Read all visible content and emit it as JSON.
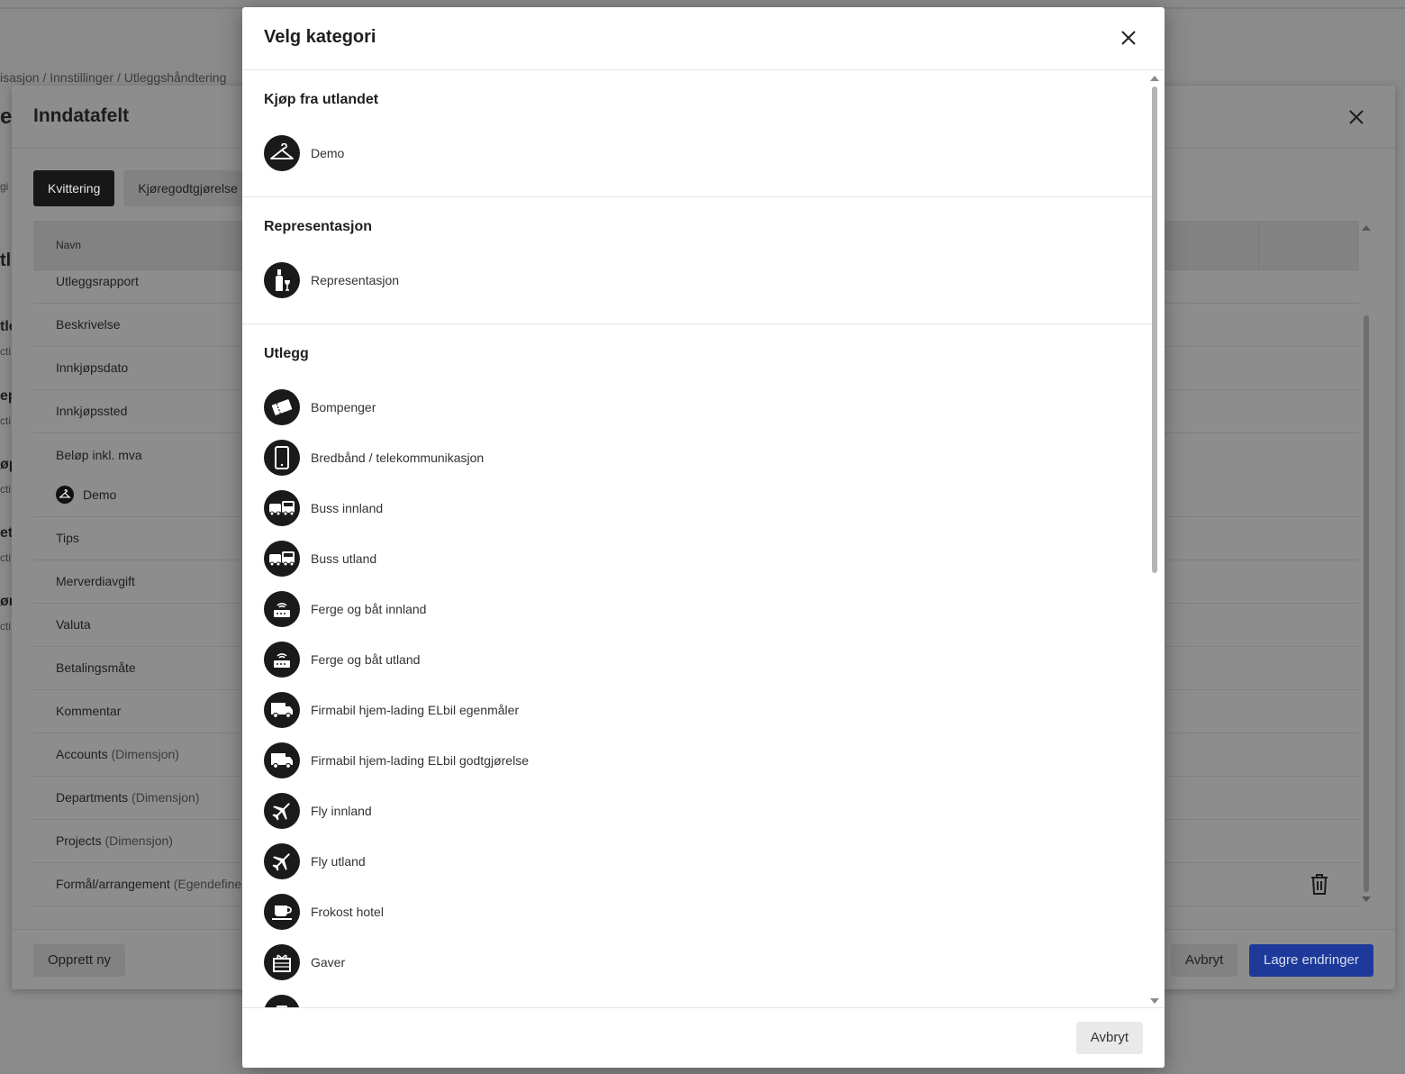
{
  "background": {
    "breadcrumb": "isasjon / Innstillinger / Utleggshåndtering",
    "left_fragments": [
      "e",
      "gi",
      "tl",
      "tle",
      "cti",
      "ep",
      "cti",
      "øp",
      "cti",
      "et",
      "cti",
      "ør",
      "cti"
    ]
  },
  "inndatafelt_modal": {
    "title": "Inndatafelt",
    "tabs": [
      "Kvittering",
      "Kjøregodtgjørelse"
    ],
    "table": {
      "header_name": "Navn",
      "rows": [
        {
          "name": "Utleggsrapport",
          "suffix": ""
        },
        {
          "name": "Beskrivelse",
          "suffix": ""
        },
        {
          "name": "Innkjøpsdato",
          "suffix": ""
        },
        {
          "name": "Innkjøpssted",
          "suffix": ""
        },
        {
          "name": "Beløp inkl. mva",
          "suffix": "",
          "sub_item": "Demo"
        },
        {
          "name": "Tips",
          "suffix": ""
        },
        {
          "name": "Merverdiavgift",
          "suffix": ""
        },
        {
          "name": "Valuta",
          "suffix": ""
        },
        {
          "name": "Betalingsmåte",
          "suffix": ""
        },
        {
          "name": "Kommentar",
          "suffix": ""
        },
        {
          "name": "Accounts",
          "suffix": "(Dimensjon)"
        },
        {
          "name": "Departments",
          "suffix": "(Dimensjon)"
        },
        {
          "name": "Projects",
          "suffix": "(Dimensjon)"
        },
        {
          "name": "Formål/arrangement",
          "suffix": "(Egendefine"
        }
      ]
    },
    "footer": {
      "create_label": "Opprett ny",
      "cancel_label": "Avbryt",
      "save_label": "Lagre endringer"
    }
  },
  "velg_kategori_modal": {
    "title": "Velg kategori",
    "sections": [
      {
        "heading": "Kjøp fra utlandet",
        "items": [
          {
            "label": "Demo",
            "icon": "hanger-icon"
          }
        ]
      },
      {
        "heading": "Representasjon",
        "items": [
          {
            "label": "Representasjon",
            "icon": "wine-icon"
          }
        ]
      },
      {
        "heading": "Utlegg",
        "items": [
          {
            "label": "Bompenger",
            "icon": "ticket-icon"
          },
          {
            "label": "Bredbånd / telekommunikasjon",
            "icon": "phone-icon"
          },
          {
            "label": "Buss innland",
            "icon": "bus-icon"
          },
          {
            "label": "Buss utland",
            "icon": "bus-icon"
          },
          {
            "label": "Ferge og båt innland",
            "icon": "ferry-icon"
          },
          {
            "label": "Ferge og båt utland",
            "icon": "ferry-icon"
          },
          {
            "label": "Firmabil hjem-lading ELbil egenmåler",
            "icon": "truck-icon"
          },
          {
            "label": "Firmabil hjem-lading ELbil godtgjørelse",
            "icon": "truck-icon"
          },
          {
            "label": "Fly innland",
            "icon": "plane-icon"
          },
          {
            "label": "Fly utland",
            "icon": "plane-icon"
          },
          {
            "label": "Frokost hotel",
            "icon": "coffee-icon"
          },
          {
            "label": "Gaver",
            "icon": "gift-icon"
          },
          {
            "label": "",
            "icon": "partial-icon"
          }
        ]
      }
    ],
    "footer": {
      "cancel_label": "Avbryt"
    }
  },
  "colors": {
    "primary_button": "#1d3a9a",
    "active_tab": "#171717",
    "icon_bg": "#1a1a1a"
  }
}
